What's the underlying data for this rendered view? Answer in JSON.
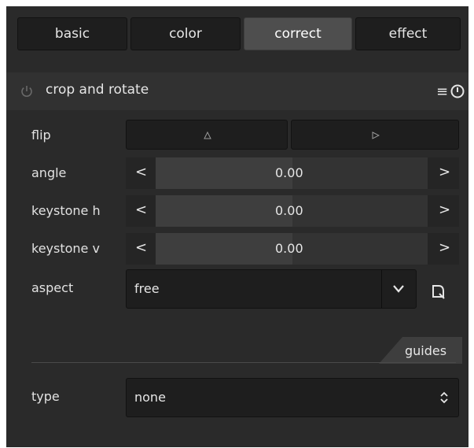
{
  "tabs": [
    {
      "label": "basic",
      "active": false
    },
    {
      "label": "color",
      "active": false
    },
    {
      "label": "correct",
      "active": true
    },
    {
      "label": "effect",
      "active": false
    }
  ],
  "module": {
    "title": "crop and rotate",
    "enabled": false,
    "icons": {
      "power": "power-icon",
      "presets": "hamburger-menu-icon",
      "reset": "reset-icon"
    }
  },
  "params": {
    "flip_label": "flip",
    "angle": {
      "label": "angle",
      "value": "0.00"
    },
    "keystone_h": {
      "label": "keystone h",
      "value": "0.00"
    },
    "keystone_v": {
      "label": "keystone v",
      "value": "0.00"
    },
    "aspect": {
      "label": "aspect",
      "value": "free"
    }
  },
  "guides": {
    "section_label": "guides",
    "type_label": "type",
    "type_value": "none"
  },
  "colors": {
    "panel_bg": "#2a2a2a",
    "active_tab": "#4e4e4e",
    "widget_bg": "#1e1e1e",
    "text": "#e2e2e2"
  }
}
